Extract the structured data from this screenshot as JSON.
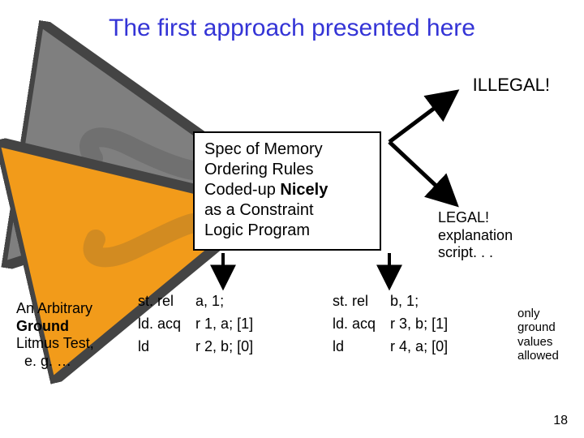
{
  "title": "The first approach presented here",
  "illegal_label": "ILLEGAL!",
  "spec_box": {
    "l1": "Spec of Memory",
    "l2": "Ordering Rules",
    "l3_a": "Coded-up ",
    "l3_b": "Nicely",
    "l4": "as a Constraint",
    "l5": "Logic Program"
  },
  "legal": {
    "l1": "LEGAL!",
    "l2": "explanation",
    "l3": "script. . ."
  },
  "left_label": {
    "l1": "An Arbitrary",
    "l2_a": "Ground",
    "l3": "Litmus Test,",
    "l4": "  e. g. …"
  },
  "right_label": {
    "l1": "only",
    "l2": "ground",
    "l3": "values",
    "l4": "allowed"
  },
  "code_left": {
    "r1_op": "st. rel",
    "r1_arg": "a, 1;",
    "r2_op": "ld. acq",
    "r2_arg": "r 1, a; [1]",
    "r3_op": "ld",
    "r3_arg": "r 2, b; [0]"
  },
  "code_right": {
    "r1_op": "st. rel",
    "r1_arg": "b, 1;",
    "r2_op": "ld. acq",
    "r2_arg": "r 3, b; [1]",
    "r3_op": "ld",
    "r3_arg": "r 4, a; [0]"
  },
  "page_number": "18"
}
